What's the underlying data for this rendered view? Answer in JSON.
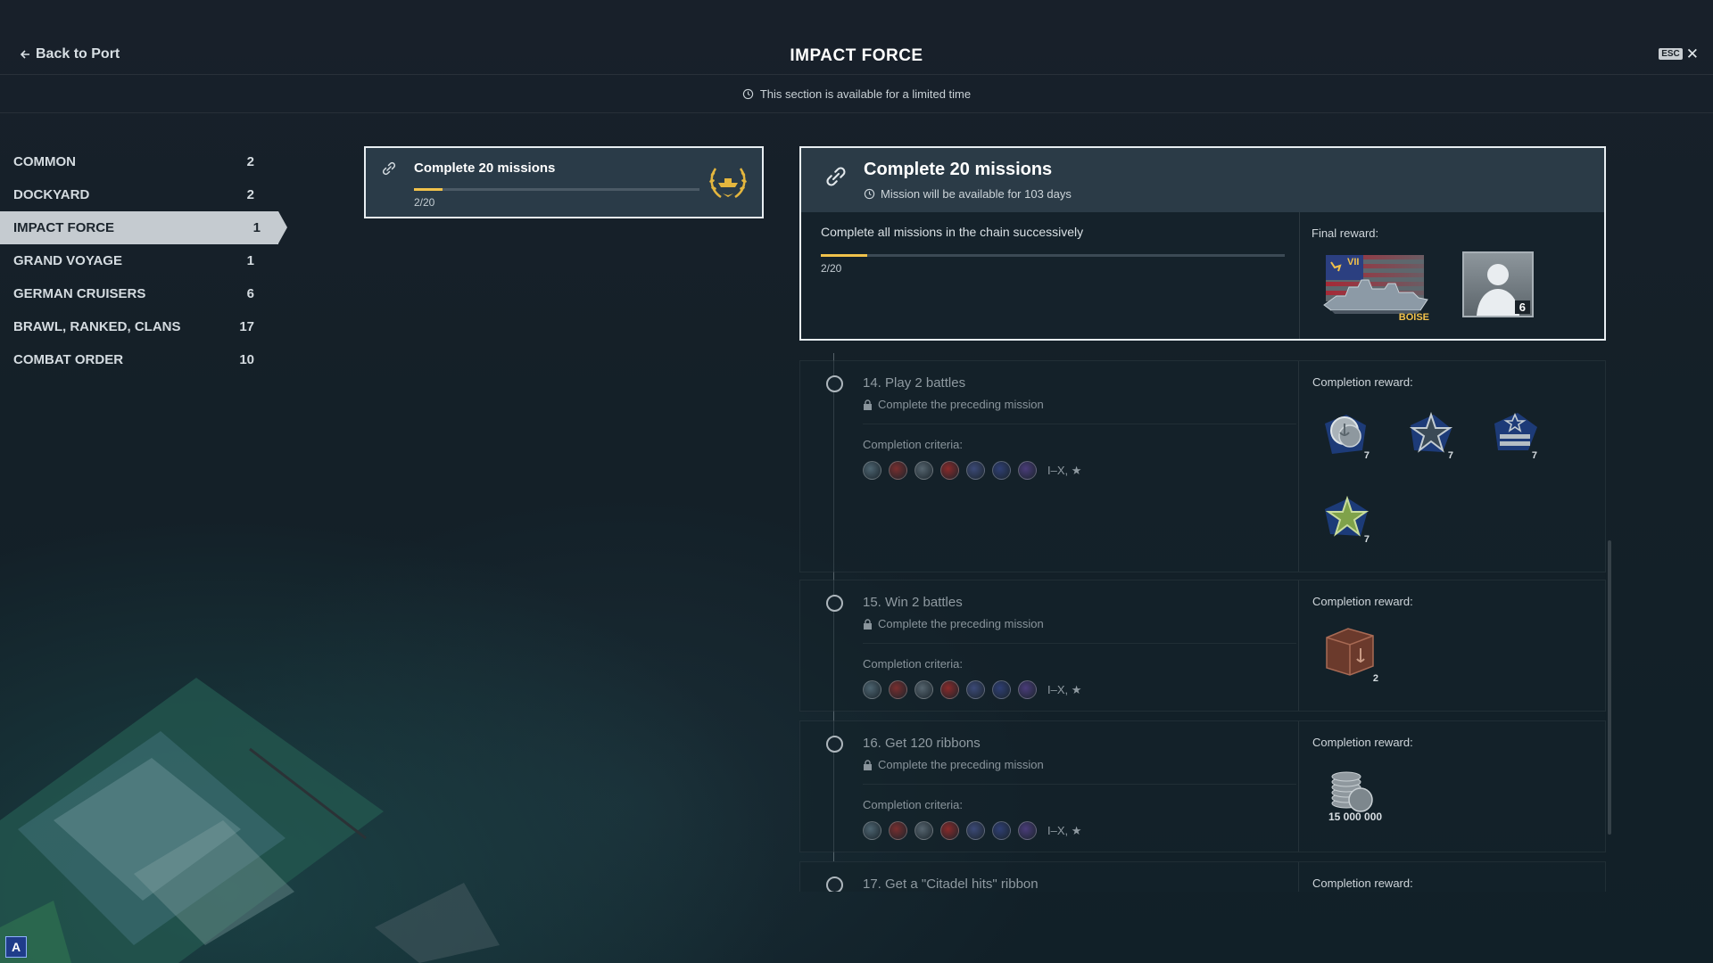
{
  "header": {
    "back_label": "Back to Port",
    "title": "IMPACT FORCE",
    "esc_label": "ESC",
    "close_glyph": "✕",
    "notice": "This section is available for a limited time"
  },
  "sidebar": {
    "items": [
      {
        "label": "COMMON",
        "count": "2",
        "active": false
      },
      {
        "label": "DOCKYARD",
        "count": "2",
        "active": false
      },
      {
        "label": "IMPACT FORCE",
        "count": "1",
        "active": true
      },
      {
        "label": "GRAND VOYAGE",
        "count": "1",
        "active": false
      },
      {
        "label": "GERMAN CRUISERS",
        "count": "6",
        "active": false
      },
      {
        "label": "BRAWL, RANKED, CLANS",
        "count": "17",
        "active": false
      },
      {
        "label": "COMBAT ORDER",
        "count": "10",
        "active": false
      }
    ]
  },
  "chain_card": {
    "title": "Complete 20 missions",
    "progress_text": "2/20",
    "progress_fraction": 0.1,
    "icon": "link-icon",
    "badge_icon": "laurel-wreath-icon"
  },
  "detail": {
    "title": "Complete 20 missions",
    "availability": "Mission will be available for 103 days",
    "description": "Complete all missions in the chain successively",
    "progress_text": "2/20",
    "progress_fraction": 0.1,
    "final_reward_label": "Final reward:",
    "ship_name": "BOISE",
    "ship_tier": "VII",
    "commander_count": "6"
  },
  "missions": [
    {
      "title": "14. Play 2 battles",
      "locked_text": "Complete the preceding mission",
      "criteria_label": "Completion criteria:",
      "tiers": "I–X, ★",
      "reward_label": "Completion reward:",
      "rewards": [
        {
          "icon": "silver-anchor-coin-icon",
          "count": "7"
        },
        {
          "icon": "silver-star-icon",
          "count": "7"
        },
        {
          "icon": "rank-stripes-icon",
          "count": "7"
        },
        {
          "icon": "green-star-icon",
          "count": "7"
        }
      ]
    },
    {
      "title": "15. Win 2 battles",
      "locked_text": "Complete the preceding mission",
      "criteria_label": "Completion criteria:",
      "tiers": "I–X, ★",
      "reward_label": "Completion reward:",
      "rewards": [
        {
          "icon": "supply-container-icon",
          "count": "2"
        }
      ]
    },
    {
      "title": "16. Get 120 ribbons",
      "locked_text": "Complete the preceding mission",
      "criteria_label": "Completion criteria:",
      "tiers": "I–X, ★",
      "reward_label": "Completion reward:",
      "rewards": [
        {
          "icon": "credits-stack-icon",
          "count": "15 000 000"
        }
      ]
    },
    {
      "title": "17. Get a \"Citadel hits\" ribbon",
      "reward_label": "Completion reward:"
    }
  ],
  "nations": [
    {
      "icon": "nation-icon-1",
      "color": "#4d6470"
    },
    {
      "icon": "nation-icon-2",
      "color": "#7a2e2e"
    },
    {
      "icon": "nation-icon-3",
      "color": "#56656f"
    },
    {
      "icon": "nation-icon-4",
      "color": "#8a2a2a"
    },
    {
      "icon": "nation-icon-5",
      "color": "#3c4a78"
    },
    {
      "icon": "nation-icon-6",
      "color": "#2f3f74"
    },
    {
      "icon": "nation-icon-7",
      "color": "#4a3c7a"
    }
  ],
  "colors": {
    "accent_progress": "#f0c24b",
    "active_tab": "#c5cbd0"
  },
  "corner_logo": "A"
}
